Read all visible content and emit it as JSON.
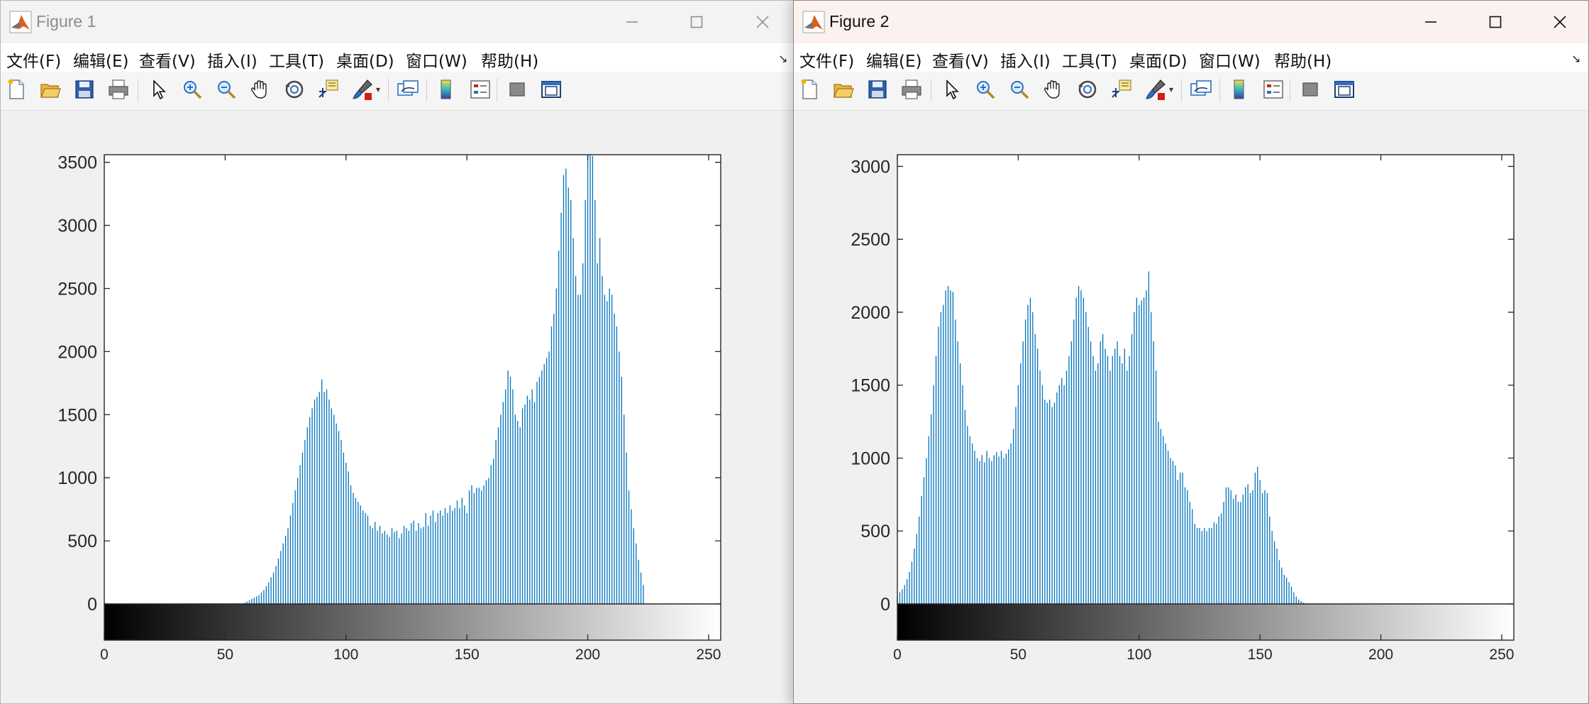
{
  "window1": {
    "title": "Figure 1",
    "menu": [
      "文件(F)",
      "编辑(E)",
      "查看(V)",
      "插入(I)",
      "工具(T)",
      "桌面(D)",
      "窗口(W)",
      "帮助(H)"
    ],
    "toolbar_icons": [
      "new-figure-icon",
      "open-file-icon",
      "save-icon",
      "print-icon",
      "pointer-icon",
      "zoom-in-icon",
      "zoom-out-icon",
      "pan-hand-icon",
      "rotate-3d-icon",
      "data-cursor-icon",
      "brush-icon",
      "link-plot-icon",
      "colorbar-icon",
      "legend-icon",
      "hide-plot-tools-icon",
      "show-plot-tools-icon"
    ]
  },
  "window2": {
    "title": "Figure 2",
    "menu": [
      "文件(F)",
      "编辑(E)",
      "查看(V)",
      "插入(I)",
      "工具(T)",
      "桌面(D)",
      "窗口(W)",
      "帮助(H)"
    ],
    "toolbar_icons": [
      "new-figure-icon",
      "open-file-icon",
      "save-icon",
      "print-icon",
      "pointer-icon",
      "zoom-in-icon",
      "zoom-out-icon",
      "pan-hand-icon",
      "rotate-3d-icon",
      "data-cursor-icon",
      "brush-icon",
      "link-plot-icon",
      "colorbar-icon",
      "legend-icon",
      "hide-plot-tools-icon",
      "show-plot-tools-icon"
    ]
  },
  "colors": {
    "bar": "#0072BD",
    "axes_bg": "#ffffff",
    "figure_bg": "#f0f0f0",
    "matlab_orange": "#d9601c"
  },
  "chart_data": [
    {
      "type": "bar",
      "title": "",
      "xlabel": "",
      "ylabel": "",
      "xlim": [
        0,
        255
      ],
      "ylim": [
        0,
        3560
      ],
      "yticks": [
        0,
        500,
        1000,
        1500,
        2000,
        2500,
        3000,
        3500
      ],
      "xticks": [
        0,
        50,
        100,
        150,
        200,
        250
      ],
      "grid": false,
      "colorbar": "gray 0-255 below x-axis",
      "series": [
        {
          "x_start": 0,
          "x_step": 1,
          "values": [
            0,
            0,
            0,
            0,
            0,
            0,
            0,
            0,
            0,
            0,
            0,
            0,
            0,
            0,
            0,
            0,
            0,
            0,
            0,
            0,
            0,
            0,
            0,
            0,
            0,
            0,
            0,
            0,
            0,
            0,
            0,
            0,
            0,
            0,
            0,
            0,
            0,
            0,
            0,
            0,
            0,
            0,
            0,
            0,
            0,
            0,
            0,
            0,
            0,
            0,
            0,
            0,
            0,
            0,
            0,
            0,
            0,
            0,
            10,
            20,
            30,
            40,
            50,
            60,
            70,
            90,
            110,
            140,
            170,
            210,
            250,
            300,
            360,
            420,
            480,
            540,
            600,
            700,
            800,
            900,
            1000,
            1100,
            1200,
            1300,
            1400,
            1480,
            1550,
            1620,
            1640,
            1680,
            1780,
            1680,
            1700,
            1620,
            1550,
            1500,
            1430,
            1370,
            1300,
            1200,
            1120,
            1050,
            940,
            880,
            840,
            810,
            780,
            740,
            720,
            700,
            620,
            600,
            650,
            580,
            620,
            560,
            580,
            550,
            530,
            600,
            570,
            580,
            520,
            560,
            620,
            600,
            580,
            640,
            660,
            580,
            640,
            600,
            610,
            720,
            620,
            700,
            740,
            650,
            720,
            740,
            700,
            760,
            720,
            780,
            740,
            760,
            820,
            760,
            840,
            780,
            720,
            900,
            940,
            880,
            920,
            920,
            900,
            940,
            980,
            1000,
            1100,
            1150,
            1300,
            1400,
            1500,
            1600,
            1700,
            1850,
            1800,
            1700,
            1500,
            1450,
            1400,
            1550,
            1580,
            1650,
            1620,
            1700,
            1600,
            1760,
            1800,
            1850,
            1900,
            1950,
            2000,
            2200,
            2300,
            2500,
            2800,
            3100,
            3400,
            3450,
            3300,
            3200,
            2900,
            2600,
            2450,
            2450,
            2700,
            3200,
            3600,
            3600,
            3550,
            3200,
            2700,
            2900,
            2600,
            2450,
            2400,
            2500,
            2450,
            2300,
            2200,
            2000,
            1800,
            1500,
            1200,
            900,
            750,
            600,
            480,
            350,
            250,
            150
          ]
        }
      ]
    },
    {
      "type": "bar",
      "title": "",
      "xlabel": "",
      "ylabel": "",
      "xlim": [
        0,
        255
      ],
      "ylim": [
        0,
        3080
      ],
      "yticks": [
        0,
        500,
        1000,
        1500,
        2000,
        2500,
        3000
      ],
      "xticks": [
        0,
        50,
        100,
        150,
        200,
        250
      ],
      "grid": false,
      "colorbar": "gray 0-255 below x-axis",
      "series": [
        {
          "x_start": 0,
          "x_step": 1,
          "values": [
            50,
            80,
            100,
            130,
            170,
            220,
            290,
            380,
            480,
            600,
            740,
            870,
            1000,
            1150,
            1300,
            1500,
            1700,
            1900,
            2000,
            2050,
            2150,
            2180,
            2150,
            2140,
            1950,
            1800,
            1650,
            1500,
            1330,
            1220,
            1150,
            1100,
            1050,
            1000,
            980,
            1020,
            970,
            1050,
            1000,
            980,
            1020,
            1040,
            1010,
            1050,
            1000,
            1030,
            1060,
            1100,
            1200,
            1350,
            1500,
            1650,
            1800,
            1950,
            2050,
            2100,
            2000,
            1850,
            1750,
            1600,
            1500,
            1400,
            1380,
            1400,
            1350,
            1380,
            1450,
            1500,
            1550,
            1500,
            1600,
            1700,
            1800,
            1950,
            2100,
            2180,
            2150,
            2100,
            2000,
            1900,
            1800,
            1700,
            1600,
            1650,
            1800,
            1850,
            1750,
            1700,
            1600,
            1700,
            1750,
            1800,
            1700,
            1650,
            1750,
            1600,
            1700,
            1850,
            2000,
            2100,
            2050,
            2080,
            2100,
            2150,
            2280,
            2000,
            1800,
            1600,
            1250,
            1200,
            1150,
            1100,
            1050,
            1000,
            980,
            950,
            850,
            900,
            900,
            800,
            780,
            700,
            650,
            550,
            520,
            520,
            500,
            520,
            500,
            520,
            520,
            560,
            550,
            600,
            620,
            700,
            800,
            800,
            780,
            720,
            750,
            700,
            700,
            750,
            800,
            820,
            760,
            780,
            900,
            940,
            850,
            760,
            780,
            760,
            600,
            500,
            430,
            380,
            300,
            250,
            200,
            180,
            150,
            120,
            80,
            50,
            30,
            20,
            10,
            5,
            0,
            0,
            0,
            0,
            0,
            0,
            0,
            0,
            0,
            0,
            0,
            0,
            0,
            0,
            0,
            0,
            0,
            0,
            0,
            0,
            0,
            0,
            0,
            0,
            0,
            0,
            0,
            0,
            0,
            0,
            0,
            0,
            0,
            0,
            0,
            0,
            0,
            0,
            0,
            0,
            0,
            0,
            0,
            0,
            0,
            0,
            0,
            0,
            0,
            0,
            0,
            0,
            0,
            0,
            0,
            0,
            0,
            0,
            0,
            0,
            0,
            0,
            0,
            0,
            0,
            0,
            0,
            0,
            0,
            0,
            0,
            0,
            0,
            0,
            0,
            0,
            0,
            0
          ]
        }
      ]
    }
  ]
}
